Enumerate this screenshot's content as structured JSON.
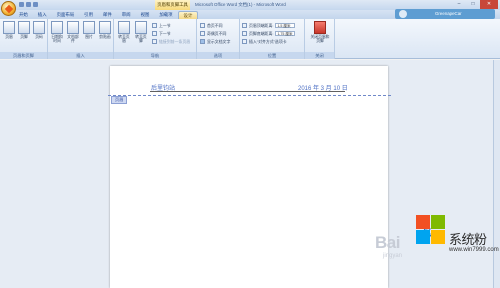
{
  "titlebar": {
    "context_label": "页眉和页脚工具",
    "doc_title": "Microsoft Office Word 文档(1) - Microsoft Word",
    "minimize": "–",
    "maximize": "□",
    "close": "✕"
  },
  "tabs": [
    "开始",
    "插入",
    "页面布局",
    "引用",
    "邮件",
    "审阅",
    "视图",
    "加载项",
    "设计"
  ],
  "user": {
    "name": "GreenapeCar"
  },
  "ribbon": {
    "groups": {
      "header_footer": "页眉和页脚",
      "insert": "插入",
      "navigation": "导航",
      "options": "选项",
      "position": "位置",
      "close": "关闭"
    },
    "header_btn": "页眉",
    "footer_btn": "页脚",
    "pagenum_btn": "页码",
    "datetime_btn": "日期和时间",
    "docparts_btn": "文档部件",
    "picture_btn": "图片",
    "clipart_btn": "剪贴画",
    "goto_header_btn": "转至页眉",
    "goto_footer_btn": "转至页脚",
    "prev_section": "上一节",
    "next_section": "下一节",
    "link_prev": "链接到前一条页眉",
    "opt_first_page": "首页不同",
    "opt_odd_even": "奇偶页不同",
    "opt_show_text": "显示文档文字",
    "pos_header_label": "页眉顶端距离:",
    "pos_header_value": "1.5 厘米",
    "pos_footer_label": "页脚底端距离:",
    "pos_footer_value": "1.75 厘米",
    "pos_insert_tab": "插入“对齐方式”选项卡",
    "close_btn": "关闭页眉和页脚"
  },
  "document": {
    "header_left": "后里钧站",
    "header_right": "2016 年 3 月 10 日",
    "header_tag": "页眉"
  },
  "watermark": {
    "baidu": "Bai",
    "baidu_sub": "jingyan",
    "site_name": "系统粉",
    "site_url": "www.win7999.com"
  },
  "colors": {
    "accent": "#15428b",
    "context_tab": "#f4d98a",
    "header_text": "#4d6fc4",
    "close_button": "#c8473a"
  }
}
